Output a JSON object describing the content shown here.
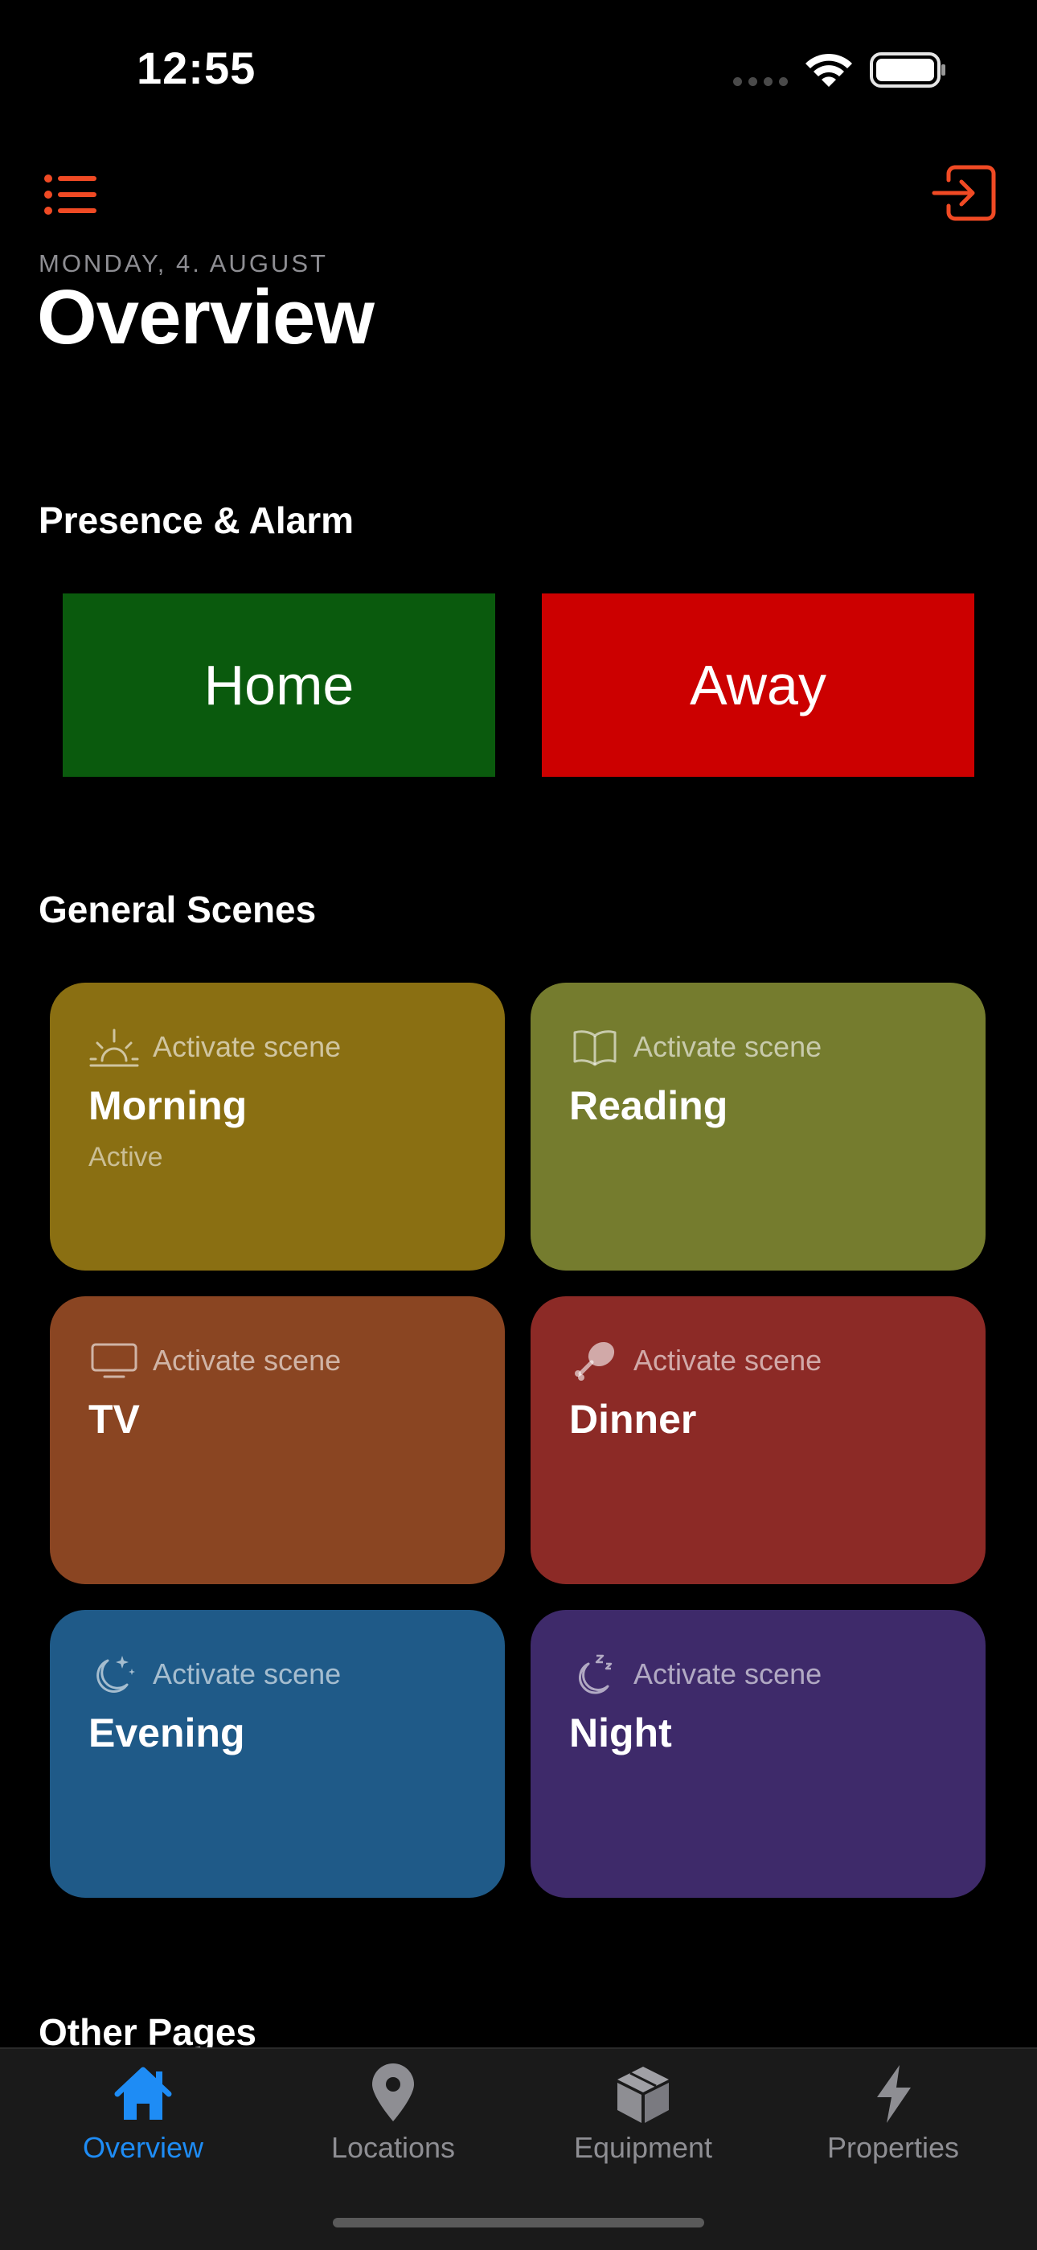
{
  "status_bar": {
    "time": "12:55"
  },
  "header": {
    "menu_icon": "list-icon",
    "logout_icon": "logout-icon",
    "date": "MONDAY, 4. AUGUST",
    "title": "Overview"
  },
  "presence": {
    "heading": "Presence & Alarm",
    "home_label": "Home",
    "away_label": "Away",
    "home_color": "#0a5a0d",
    "away_color": "#cc0000"
  },
  "scenes": {
    "heading": "General Scenes",
    "items": [
      {
        "name": "Morning",
        "action": "Activate scene",
        "state": "Active",
        "icon": "sunrise-icon",
        "color": "#8a6f12"
      },
      {
        "name": "Reading",
        "action": "Activate scene",
        "state": "",
        "icon": "book-icon",
        "color": "#757c2e"
      },
      {
        "name": "TV",
        "action": "Activate scene",
        "state": "",
        "icon": "tv-icon",
        "color": "#8a4522"
      },
      {
        "name": "Dinner",
        "action": "Activate scene",
        "state": "",
        "icon": "drumstick-icon",
        "color": "#8c2a26"
      },
      {
        "name": "Evening",
        "action": "Activate scene",
        "state": "",
        "icon": "moon-stars-icon",
        "color": "#1f5a88"
      },
      {
        "name": "Night",
        "action": "Activate scene",
        "state": "",
        "icon": "moon-zzz-icon",
        "color": "#3e2a6a"
      }
    ]
  },
  "other_pages": {
    "heading": "Other Pages"
  },
  "tabbar": {
    "tabs": [
      {
        "label": "Overview",
        "icon": "house-icon",
        "active": true
      },
      {
        "label": "Locations",
        "icon": "map-pin-icon",
        "active": false
      },
      {
        "label": "Equipment",
        "icon": "cube-icon",
        "active": false
      },
      {
        "label": "Properties",
        "icon": "bolt-icon",
        "active": false
      }
    ],
    "active_color": "#1e8cf5"
  },
  "accent_color": "#f04a24"
}
